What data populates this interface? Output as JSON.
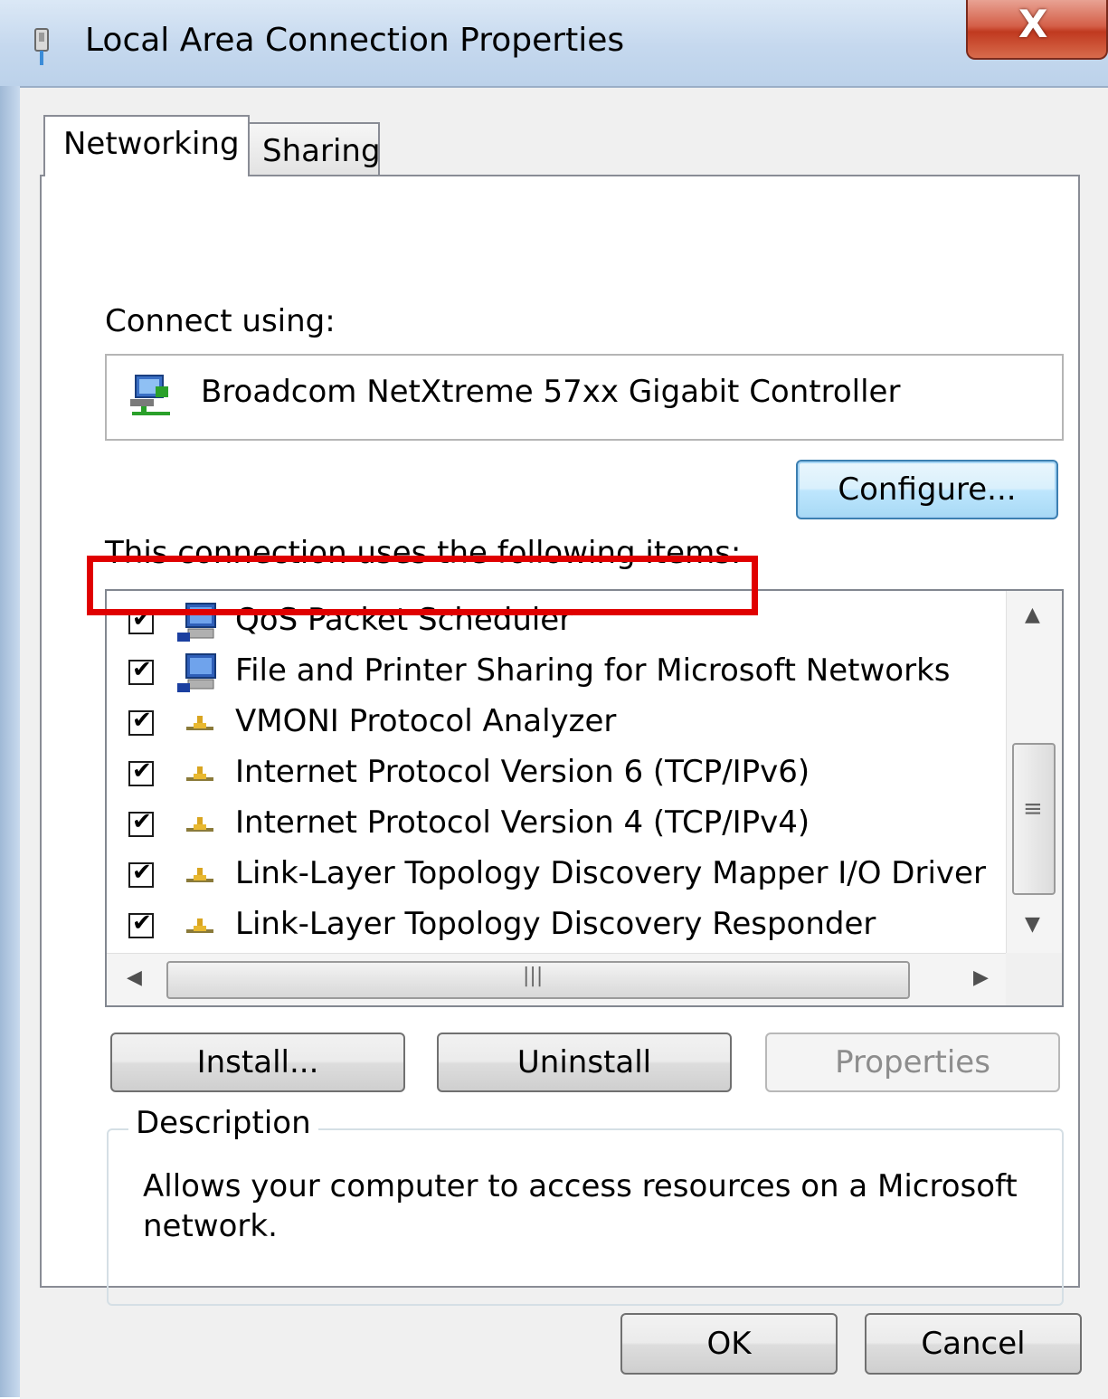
{
  "window": {
    "title": "Local Area Connection Properties",
    "close_glyph": "X"
  },
  "tabs": [
    {
      "label": "Networking",
      "selected": true
    },
    {
      "label": "Sharing",
      "selected": false
    }
  ],
  "connect_using": {
    "label": "Connect using:",
    "adapter_name": "Broadcom NetXtreme 57xx Gigabit Controller",
    "adapter_icon": "network-adapter-icon"
  },
  "buttons": {
    "configure": "Configure...",
    "install": "Install...",
    "uninstall": "Uninstall",
    "properties": "Properties",
    "ok": "OK",
    "cancel": "Cancel"
  },
  "items_label": "This connection uses the following items:",
  "items": [
    {
      "label": "QoS Packet Scheduler",
      "checked": true,
      "icon": "service-computer-icon"
    },
    {
      "label": "File and Printer Sharing for Microsoft Networks",
      "checked": true,
      "icon": "service-computer-icon"
    },
    {
      "label": "VMONI Protocol Analyzer",
      "checked": true,
      "icon": "protocol-icon"
    },
    {
      "label": "Internet Protocol Version 6 (TCP/IPv6)",
      "checked": true,
      "icon": "protocol-icon",
      "highlighted": true
    },
    {
      "label": "Internet Protocol Version 4 (TCP/IPv4)",
      "checked": true,
      "icon": "protocol-icon"
    },
    {
      "label": "Link-Layer Topology Discovery Mapper I/O Driver",
      "checked": true,
      "icon": "protocol-icon"
    },
    {
      "label": "Link-Layer Topology Discovery Responder",
      "checked": true,
      "icon": "protocol-icon"
    }
  ],
  "description": {
    "legend": "Description",
    "text": "Allows your computer to access resources on a Microsoft network."
  },
  "colors": {
    "highlight_border": "#e00000",
    "configure_focus": "#3c7fb1",
    "close_button": "#c0391f"
  }
}
